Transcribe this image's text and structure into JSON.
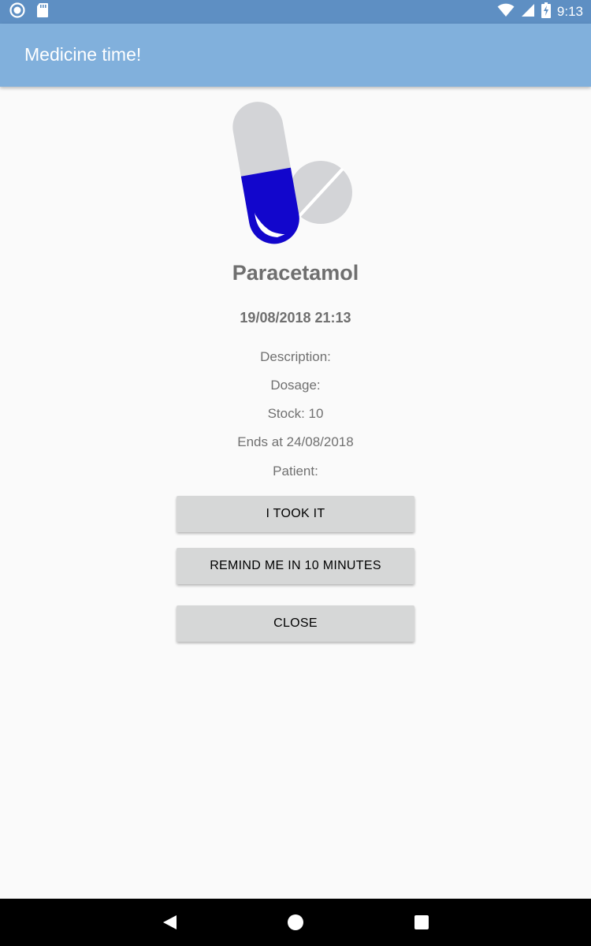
{
  "status_bar": {
    "time": "9:13",
    "left_icons": [
      "circle-notification-icon",
      "sd-card-icon"
    ],
    "right_icons": [
      "wifi-icon",
      "cell-signal-icon",
      "battery-charging-icon"
    ],
    "color": "#5e8fc3"
  },
  "app_bar": {
    "title": "Medicine time!",
    "color": "#81b0dc"
  },
  "medicine": {
    "icon": "pill-capsule-icon",
    "name": "Paracetamol",
    "datetime": "19/08/2018 21:13",
    "description": "Description:",
    "dosage": "Dosage:",
    "stock": "Stock: 10",
    "ends": "Ends at 24/08/2018",
    "patient": "Patient:"
  },
  "actions": {
    "took_label": "I TOOK IT",
    "remind_label": "REMIND ME IN 10 MINUTES",
    "close_label": "CLOSE"
  },
  "nav_bar": {
    "back_icon": "back-triangle-icon",
    "home_icon": "home-circle-icon",
    "recents_icon": "recents-square-icon"
  }
}
